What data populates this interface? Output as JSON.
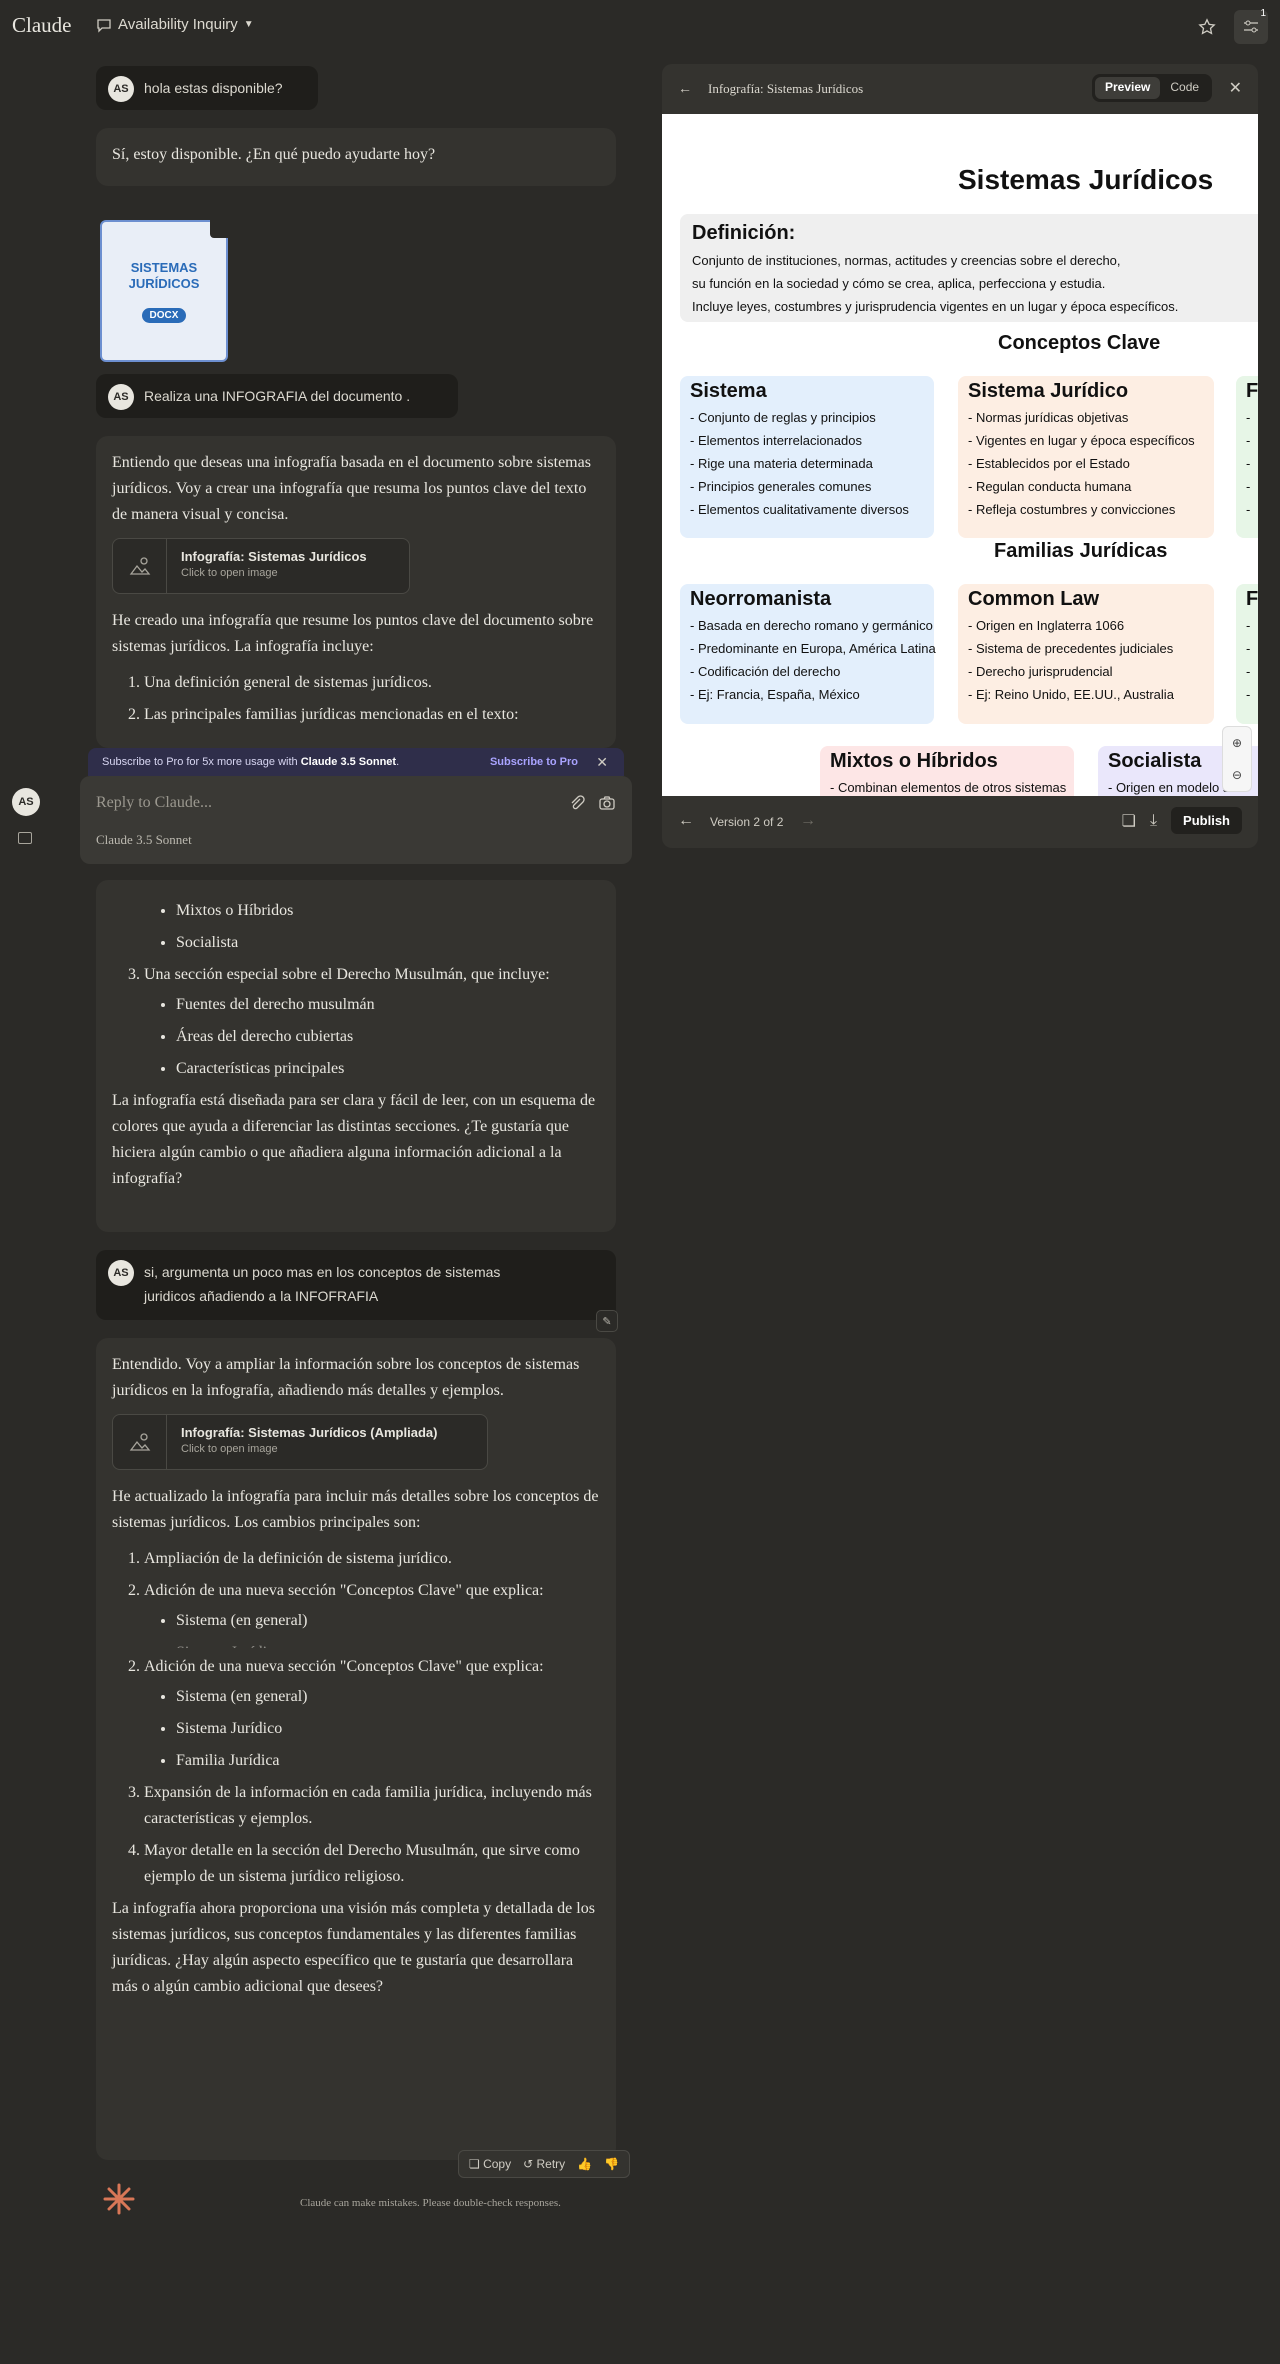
{
  "app": {
    "logo": "Claude",
    "chat_title": "Availability Inquiry",
    "notification_count": "1"
  },
  "messages": {
    "u1": {
      "avatar": "AS",
      "text": "hola estas disponible?"
    },
    "a1": {
      "text": "Sí, estoy disponible. ¿En qué puedo ayudarte hoy?"
    },
    "doc": {
      "title": "SISTEMAS JURÍDICOS",
      "type": "DOCX"
    },
    "u2": {
      "avatar": "AS",
      "text": "Realiza una INFOGRAFIA del documento ."
    },
    "a2": {
      "intro": "Entiendo que deseas una infografía basada en el documento sobre sistemas jurídicos. Voy a crear una infografía que resuma los puntos clave del texto de manera visual y concisa.",
      "artifact_title": "Infografía: Sistemas Jurídicos",
      "artifact_sub": "Click to open image",
      "p2": "He creado una infografía que resume los puntos clave del documento sobre sistemas jurídicos. La infografía incluye:",
      "li1": "Una definición general de sistemas jurídicos.",
      "li2": "Las principales familias jurídicas mencionadas en el texto:",
      "li2_sub1": "Mixtos o Híbridos",
      "li2_sub2": "Socialista",
      "li3": "Una sección especial sobre el Derecho Musulmán, que incluye:",
      "li3_sub1": "Fuentes del derecho musulmán",
      "li3_sub2": "Áreas del derecho cubiertas",
      "li3_sub3": "Características principales",
      "outro": "La infografía está diseñada para ser clara y fácil de leer, con un esquema de colores que ayuda a diferenciar las distintas secciones. ¿Te gustaría que hiciera algún cambio o que añadiera alguna información adicional a la infografía?"
    },
    "u3": {
      "avatar": "AS",
      "text": "si, argumenta un poco mas en los conceptos de sistemas juridicos añadiendo a la INFOFRAFIA"
    },
    "a3": {
      "intro": "Entendido. Voy a ampliar la información sobre los conceptos de sistemas jurídicos en la infografía, añadiendo más detalles y ejemplos.",
      "artifact_title": "Infografía: Sistemas Jurídicos (Ampliada)",
      "artifact_sub": "Click to open image",
      "p2": "He actualizado la infografía para incluir más detalles sobre los conceptos de sistemas jurídicos. Los cambios principales son:",
      "li1": "Ampliación de la definición de sistema jurídico.",
      "li2": "Adición de una nueva sección \"Conceptos Clave\" que explica:",
      "li2_sub1": "Sistema (en general)",
      "li2_sub2": "Sistema Jurídico",
      "li2_sub3": "Familia Jurídica",
      "li3": "Expansión de la información en cada familia jurídica, incluyendo más características y ejemplos.",
      "li4": "Mayor detalle en la sección del Derecho Musulmán, que sirve como ejemplo de un sistema jurídico religioso.",
      "outro": "La infografía ahora proporciona una visión más completa y detallada de los sistemas jurídicos, sus conceptos fundamentales y las diferentes familias jurídicas. ¿Hay algún aspecto específico que te gustaría que desarrollara más o algún cambio adicional que desees?",
      "actions": {
        "copy": "Copy",
        "retry": "Retry"
      }
    }
  },
  "promo": {
    "text_prefix": "Subscribe to Pro for 5x more usage with ",
    "text_model": "Claude 3.5 Sonnet",
    "text_suffix": ".",
    "cta": "Subscribe to Pro"
  },
  "composer": {
    "placeholder": "Reply to Claude...",
    "model": "Claude 3.5 Sonnet"
  },
  "sidebar": {
    "avatar": "AS"
  },
  "panel": {
    "title": "Infografía: Sistemas Jurídicos",
    "tab_preview": "Preview",
    "tab_code": "Code",
    "version": "Version 2 of 2",
    "publish": "Publish",
    "infographic": {
      "title": "Sistemas Jurídicos",
      "def_heading": "Definición:",
      "def_l1": "Conjunto de instituciones, normas, actitudes y creencias sobre el derecho,",
      "def_l2": "su función en la sociedad y cómo se crea, aplica, perfecciona y estudia.",
      "def_l3": "Incluye leyes, costumbres y jurisprudencia vigentes en un lugar y época específicos.",
      "conceptos_heading": "Conceptos Clave",
      "sistema": {
        "heading": "Sistema",
        "lines": [
          "- Conjunto de reglas y principios",
          "- Elementos interrelacionados",
          "- Rige una materia determinada",
          "- Principios generales comunes",
          "- Elementos cualitativamente diversos"
        ]
      },
      "sistema_juridico": {
        "heading": "Sistema Jurídico",
        "lines": [
          "- Normas jurídicas objetivas",
          "- Vigentes en lugar y época específicos",
          "- Establecidos por el Estado",
          "- Regulan conducta humana",
          "- Refleja costumbres y convicciones"
        ]
      },
      "familias_heading": "Familias Jurídicas",
      "neorromanista": {
        "heading": "Neorromanista",
        "lines": [
          "- Basada en derecho romano y germánico",
          "- Predominante en Europa, América Latina",
          "- Codificación del derecho",
          "- Ej: Francia, España, México"
        ]
      },
      "common_law": {
        "heading": "Common Law",
        "lines": [
          "- Origen en Inglaterra 1066",
          "- Sistema de precedentes judiciales",
          "- Derecho jurisprudencial",
          "- Ej: Reino Unido, EE.UU., Australia"
        ]
      },
      "mixtos": {
        "heading": "Mixtos o Híbridos",
        "line1": "- Combinan elementos de otros sistemas"
      },
      "socialista": {
        "heading": "Socialista",
        "line1": "- Origen en modelo sov"
      },
      "cut_heading": "F",
      "cut_line": "-"
    }
  },
  "footer": {
    "disclaimer": "Claude can make mistakes. Please double-check responses."
  }
}
